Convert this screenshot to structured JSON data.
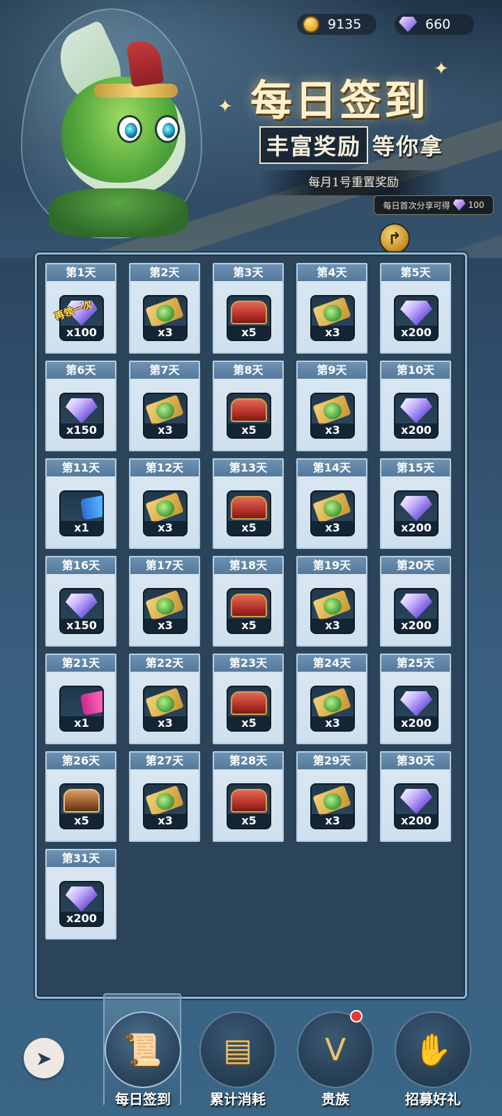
{
  "currency": {
    "coins": {
      "value": "9135",
      "icon": "coin-icon"
    },
    "gems": {
      "value": "660",
      "icon": "gem-icon"
    }
  },
  "banner": {
    "title": "每日签到",
    "subtitle_box": "丰富奖励",
    "subtitle_rest": "等你拿",
    "reset_note": "每月1号重置奖励",
    "share_tip_text": "每日首次分享可得",
    "share_tip_amount": "100"
  },
  "days": [
    {
      "label": "第1天",
      "item": "diamond",
      "qty": "x100",
      "tag": "再领一次"
    },
    {
      "label": "第2天",
      "item": "ticket",
      "qty": "x3"
    },
    {
      "label": "第3天",
      "item": "chest-red",
      "qty": "x5"
    },
    {
      "label": "第4天",
      "item": "ticket",
      "qty": "x3"
    },
    {
      "label": "第5天",
      "item": "diamond",
      "qty": "x200"
    },
    {
      "label": "第6天",
      "item": "diamond",
      "qty": "x150"
    },
    {
      "label": "第7天",
      "item": "ticket",
      "qty": "x3"
    },
    {
      "label": "第8天",
      "item": "chest-red",
      "qty": "x5"
    },
    {
      "label": "第9天",
      "item": "ticket",
      "qty": "x3"
    },
    {
      "label": "第10天",
      "item": "diamond",
      "qty": "x200"
    },
    {
      "label": "第11天",
      "item": "scroll-blue",
      "qty": "x1"
    },
    {
      "label": "第12天",
      "item": "ticket",
      "qty": "x3"
    },
    {
      "label": "第13天",
      "item": "chest-red",
      "qty": "x5"
    },
    {
      "label": "第14天",
      "item": "ticket",
      "qty": "x3"
    },
    {
      "label": "第15天",
      "item": "diamond",
      "qty": "x200"
    },
    {
      "label": "第16天",
      "item": "diamond",
      "qty": "x150"
    },
    {
      "label": "第17天",
      "item": "ticket",
      "qty": "x3"
    },
    {
      "label": "第18天",
      "item": "chest-red",
      "qty": "x5"
    },
    {
      "label": "第19天",
      "item": "ticket",
      "qty": "x3"
    },
    {
      "label": "第20天",
      "item": "diamond",
      "qty": "x200"
    },
    {
      "label": "第21天",
      "item": "scroll-pink",
      "qty": "x1"
    },
    {
      "label": "第22天",
      "item": "ticket",
      "qty": "x3"
    },
    {
      "label": "第23天",
      "item": "chest-red",
      "qty": "x5"
    },
    {
      "label": "第24天",
      "item": "ticket",
      "qty": "x3"
    },
    {
      "label": "第25天",
      "item": "diamond",
      "qty": "x200"
    },
    {
      "label": "第26天",
      "item": "chest-brown",
      "qty": "x5"
    },
    {
      "label": "第27天",
      "item": "ticket",
      "qty": "x3"
    },
    {
      "label": "第28天",
      "item": "chest-red",
      "qty": "x5"
    },
    {
      "label": "第29天",
      "item": "ticket",
      "qty": "x3"
    },
    {
      "label": "第30天",
      "item": "diamond",
      "qty": "x200"
    },
    {
      "label": "第31天",
      "item": "diamond",
      "qty": "x200"
    }
  ],
  "nav": {
    "back_icon": "back-arrow-icon",
    "tabs": [
      {
        "label": "每日签到",
        "icon": "scroll-icon",
        "active": true
      },
      {
        "label": "累计消耗",
        "icon": "bar-chart-icon",
        "active": false
      },
      {
        "label": "贵族",
        "icon": "vip-badge-icon",
        "active": false,
        "badge": true
      },
      {
        "label": "招募好礼",
        "icon": "gift-hand-icon",
        "active": false
      }
    ]
  }
}
